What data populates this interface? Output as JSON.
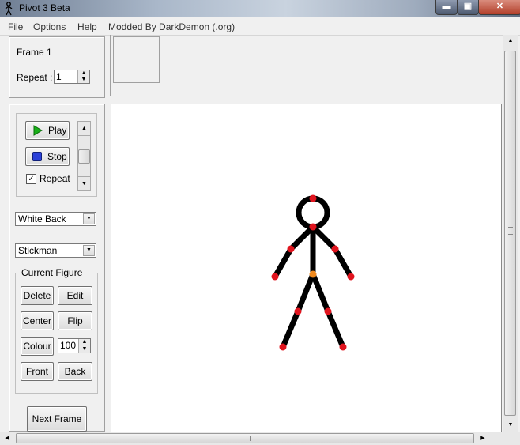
{
  "window": {
    "title": "Pivot 3 Beta",
    "min_glyph": "▬",
    "max_glyph": "▣",
    "close_glyph": "✕"
  },
  "menu": [
    "File",
    "Options",
    "Help",
    "Modded By DarkDemon (.org)"
  ],
  "frame_panel": {
    "frame_label": "Frame 1",
    "repeat_label": "Repeat :",
    "repeat_value": "1"
  },
  "playback": {
    "play_label": "Play",
    "stop_label": "Stop",
    "repeat_checkbox_label": "Repeat",
    "repeat_checked": true
  },
  "background_select": {
    "value": "White Back"
  },
  "figure_type_select": {
    "value": "Stickman"
  },
  "current_figure": {
    "group_label": "Current Figure",
    "delete_label": "Delete",
    "edit_label": "Edit",
    "center_label": "Center",
    "flip_label": "Flip",
    "colour_label": "Colour",
    "colour_value": "100",
    "front_label": "Front",
    "back_label": "Back"
  },
  "next_frame_label": "Next Frame",
  "colors": {
    "figure": "#000000",
    "joint": "#e0141e",
    "pivot_joint": "#f08a1e",
    "canvas": "#ffffff"
  }
}
